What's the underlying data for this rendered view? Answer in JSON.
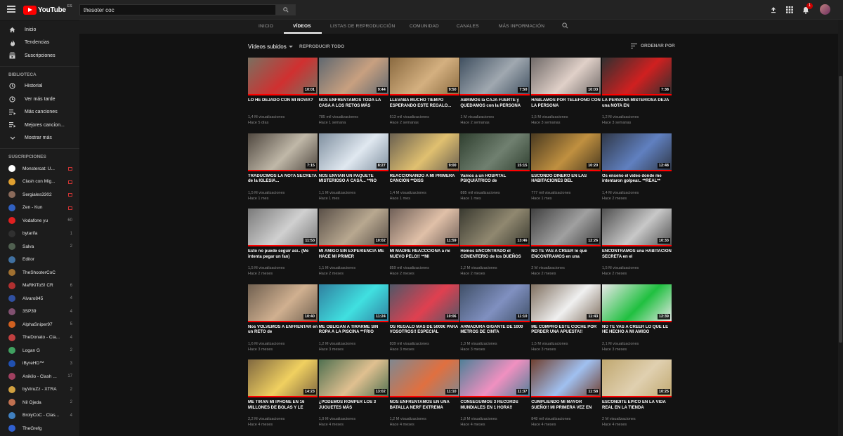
{
  "app": {
    "logo_text": "YouTube",
    "logo_region": "ES",
    "search_value": "thesoter coc",
    "notification_count": "1"
  },
  "sidebar": {
    "main": [
      {
        "label": "Inicio",
        "icon": "home-icon"
      },
      {
        "label": "Tendencias",
        "icon": "flame-icon"
      },
      {
        "label": "Suscripciones",
        "icon": "subscriptions-icon"
      }
    ],
    "library_heading": "BIBLIOTECA",
    "library": [
      {
        "label": "Historial",
        "icon": "history-icon"
      },
      {
        "label": "Ver más tarde",
        "icon": "clock-icon"
      },
      {
        "label": "Más canciones",
        "icon": "playlist-icon"
      },
      {
        "label": "Mejores cancion...",
        "icon": "playlist-icon"
      },
      {
        "label": "Mostrar más",
        "icon": "chevron-down-icon"
      }
    ],
    "subs_heading": "SUSCRIPCIONES",
    "subscriptions": [
      {
        "name": "Monstercat: U...",
        "right": "live",
        "color": "#ffffff"
      },
      {
        "name": "Clash con Mig...",
        "right": "live",
        "color": "#e0a030"
      },
      {
        "name": "Sergiales3302",
        "right": "live",
        "color": "#8a6a5a"
      },
      {
        "name": "Zen - Kun",
        "right": "live",
        "color": "#3060c0"
      },
      {
        "name": "Vodafone yu",
        "right": "60",
        "color": "#e02020"
      },
      {
        "name": "bytarifa",
        "right": "1",
        "color": "#303030"
      },
      {
        "name": "Salva",
        "right": "2",
        "color": "#506050"
      },
      {
        "name": "Editor",
        "right": "",
        "color": "#4070a0"
      },
      {
        "name": "TheShooterCoC",
        "right": "",
        "color": "#a07030"
      },
      {
        "name": "MaRKiToS! CR",
        "right": "6",
        "color": "#b03030"
      },
      {
        "name": "Alvaro845",
        "right": "4",
        "color": "#3050a0"
      },
      {
        "name": "3SP39",
        "right": "4",
        "color": "#805070"
      },
      {
        "name": "AlphaSniper97",
        "right": "5",
        "color": "#d06020"
      },
      {
        "name": "TheDonato - Cla...",
        "right": "4",
        "color": "#c04040"
      },
      {
        "name": "Logan G",
        "right": "2",
        "color": "#40a060"
      },
      {
        "name": "iByreHD™",
        "right": "3",
        "color": "#2050b0"
      },
      {
        "name": "Anikilo - Clash ...",
        "right": "17",
        "color": "#a04060"
      },
      {
        "name": "byViruZz - XTRA",
        "right": "2",
        "color": "#d0a040"
      },
      {
        "name": "Nil Ojeda",
        "right": "2",
        "color": "#c07050"
      },
      {
        "name": "BrolyCoC - Clas...",
        "right": "4",
        "color": "#4080c0"
      },
      {
        "name": "TheGrefg",
        "right": "",
        "color": "#3060d0"
      }
    ]
  },
  "tabs": [
    "INICIO",
    "VÍDEOS",
    "LISTAS DE REPRODUCCIÓN",
    "COMUNIDAD",
    "CANALES",
    "MÁS INFORMACIÓN"
  ],
  "subheader": {
    "uploads": "Vídeos subidos",
    "play_all": "REPRODUCIR TODO",
    "sort": "ORDENAR POR"
  },
  "videos": [
    {
      "title": "LO HE DEJADO CON MI NOVIA?",
      "views": "1,4 M visualizaciones",
      "age": "Hace 5 días",
      "duration": "10:01",
      "bg": "#7a7060",
      "accent": "#d03030"
    },
    {
      "title": "NOS ENFRENTAMOS TODA LA CASA A LOS RETOS MÁS",
      "views": "785 mil visualizaciones",
      "age": "Hace 1 semana",
      "duration": "9:44",
      "bg": "#606870",
      "accent": "#c8a080"
    },
    {
      "title": "LLEVABA MUCHO TIEMPO ESPERANDO ESTE REGALO...",
      "views": "613 mil visualizaciones",
      "age": "Hace 2 semanas",
      "duration": "9:50",
      "bg": "#8a6a40",
      "accent": "#d4b080"
    },
    {
      "title": "ABRIMOS la CAJA FUERTE y QUEDAMOS con la PERSONA",
      "views": "1 M visualizaciones",
      "age": "Hace 2 semanas",
      "duration": "7:50",
      "bg": "#405060",
      "accent": "#a0a8b0"
    },
    {
      "title": "HABLAMOS POR TELÉFONO CON LA PERSONA",
      "views": "1,5 M visualizaciones",
      "age": "Hace 3 semanas",
      "duration": "10:03",
      "bg": "#706a68",
      "accent": "#e0d0c8"
    },
    {
      "title": "LA PERSONA MISTERIOSA DEJA una NOTA EN",
      "views": "1,2 M visualizaciones",
      "age": "Hace 3 semanas",
      "duration": "7:38",
      "bg": "#303030",
      "accent": "#d02020"
    },
    {
      "title": "TRADUCIMOS LA NOTA SECRETA de la IGLESIA...",
      "views": "1,5 M visualizaciones",
      "age": "Hace 1 mes",
      "duration": "7:15",
      "bg": "#504840",
      "accent": "#c0b8a8"
    },
    {
      "title": "NOS ENVIAN UN PAQUETE MISTERIOSO A CASA... **NO",
      "views": "1,1 M visualizaciones",
      "age": "Hace 1 mes",
      "duration": "8:27",
      "bg": "#8090a0",
      "accent": "#e0e8f0"
    },
    {
      "title": "REACCIONANDO A MI PRIMERA CANCIÓN **DISS",
      "views": "1,4 M visualizaciones",
      "age": "Hace 1 mes",
      "duration": "9:00",
      "bg": "#6a6050",
      "accent": "#e0c070"
    },
    {
      "title": "Vamos a un HOSPITAL PSIQUIÁTRICO de",
      "views": "885 mil visualizaciones",
      "age": "Hace 1 mes",
      "duration": "15:15",
      "bg": "#304030",
      "accent": "#708070"
    },
    {
      "title": "ESCONDO DINERO EN LAS HABITACIONES DEL",
      "views": "777 mil visualizaciones",
      "age": "Hace 1 mes",
      "duration": "10:20",
      "bg": "#4a3a20",
      "accent": "#c09040"
    },
    {
      "title": "Os enseño el vídeo donde me intentaron golpear.. **REAL**",
      "views": "1,4 M visualizaciones",
      "age": "Hace 2 meses",
      "duration": "12:48",
      "bg": "#303848",
      "accent": "#6080c0"
    },
    {
      "title": "Esto no puede seguir así.. (Me intenta pegar un fan)",
      "views": "1,5 M visualizaciones",
      "age": "Hace 2 meses",
      "duration": "11:53",
      "bg": "#7a7a7a",
      "accent": "#d0d0d0"
    },
    {
      "title": "MI AMIGO SIN EXPERIENCIA ME HACE MI PRIMER",
      "views": "1,1 M visualizaciones",
      "age": "Hace 2 meses",
      "duration": "10:02",
      "bg": "#5a5048",
      "accent": "#b8a890"
    },
    {
      "title": "MI MADRE REACCCIONA a mi NUEVO PELO!! **MI",
      "views": "859 mil visualizaciones",
      "age": "Hace 2 meses",
      "duration": "11:59",
      "bg": "#706058",
      "accent": "#e0c0a8"
    },
    {
      "title": "Hemos ENCONTRADO el CEMENTERIO de los DUEÑOS",
      "views": "1,2 M visualizaciones",
      "age": "Hace 2 meses",
      "duration": "13:46",
      "bg": "#3a3a30",
      "accent": "#908870"
    },
    {
      "title": "NO TE VAS A CREER lo que ENCONTRAMOS en una",
      "views": "2 M visualizaciones",
      "age": "Hace 2 meses",
      "duration": "12:26",
      "bg": "#404040",
      "accent": "#a0a0a0"
    },
    {
      "title": "ENCONTRAMOS una HABITACIÓN SECRETA en el",
      "views": "1,5 M visualizaciones",
      "age": "Hace 2 meses",
      "duration": "10:33",
      "bg": "#505050",
      "accent": "#c8c8c8"
    },
    {
      "title": "Nos VOLVEMOS A ENFRENTAR en un RETO de",
      "views": "1,6 M visualizaciones",
      "age": "Hace 3 meses",
      "duration": "10:40",
      "bg": "#706050",
      "accent": "#d0b090"
    },
    {
      "title": "ME OBLIGAN A TIRARME SIN ROPA A LA PISCINA **FRIO",
      "views": "1,2 M visualizaciones",
      "age": "Hace 3 meses",
      "duration": "11:24",
      "bg": "#3080a0",
      "accent": "#40e0e0"
    },
    {
      "title": "OS REGALO MÁS DE 5000€ PARA VOSOTROS!! ESPECIAL",
      "views": "839 mil visualizaciones",
      "age": "Hace 3 meses",
      "duration": "10:06",
      "bg": "#505868",
      "accent": "#e04050"
    },
    {
      "title": "ARMADURA GIGANTE DE 1000 METROS DE CINTA",
      "views": "1,3 M visualizaciones",
      "age": "Hace 3 meses",
      "duration": "11:10",
      "bg": "#405068",
      "accent": "#8090c0"
    },
    {
      "title": "ME COMPRO ESTE COCHE POR PERDER UNA APUESTA!!",
      "views": "1,5 M visualizaciones",
      "age": "Hace 3 meses",
      "duration": "11:43",
      "bg": "#807060",
      "accent": "#f0f0f0"
    },
    {
      "title": "NO TE VAS A CREER LO QUE LE HE HECHO A MI AMIGO",
      "views": "2,1 M visualizaciones",
      "age": "Hace 3 meses",
      "duration": "12:39",
      "bg": "#e8e8e8",
      "accent": "#20c040"
    },
    {
      "title": "ME TIRAN MI IPHONE EN 16 MILLONES DE BOLAS Y LE",
      "views": "2,2 M visualizaciones",
      "age": "Hace 4 meses",
      "duration": "14:23",
      "bg": "#806840",
      "accent": "#f0d060"
    },
    {
      "title": "¿PODEMOS ROMPER LOS 3 JUGUETES MÁS",
      "views": "1,9 M visualizaciones",
      "age": "Hace 4 meses",
      "duration": "13:02",
      "bg": "#507050",
      "accent": "#e0c090"
    },
    {
      "title": "NOS ENFRENTAMOS EN UNA BATALLA NERF EXTREMA",
      "views": "1,2 M visualizaciones",
      "age": "Hace 4 meses",
      "duration": "11:10",
      "bg": "#808890",
      "accent": "#e07040"
    },
    {
      "title": "CONSEGUIMOS 3 RÉCORDS MUNDIALES EN 1 HORA!!",
      "views": "1,8 M visualizaciones",
      "age": "Hace 4 meses",
      "duration": "11:37",
      "bg": "#508098",
      "accent": "#f090c0"
    },
    {
      "title": "CUMPLIENDO MI MAYOR SUEÑO!! MI PRIMERA VEZ EN",
      "views": "848 mil visualizaciones",
      "age": "Hace 4 meses",
      "duration": "11:58",
      "bg": "#704030",
      "accent": "#a0c0f0"
    },
    {
      "title": "ESCONDITE ÉPICO EN LA VIDA REAL EN LA TIENDA",
      "views": "2 M visualizaciones",
      "age": "Hace 4 meses",
      "duration": "10:25",
      "bg": "#c0a870",
      "accent": "#e0d0b0"
    }
  ]
}
